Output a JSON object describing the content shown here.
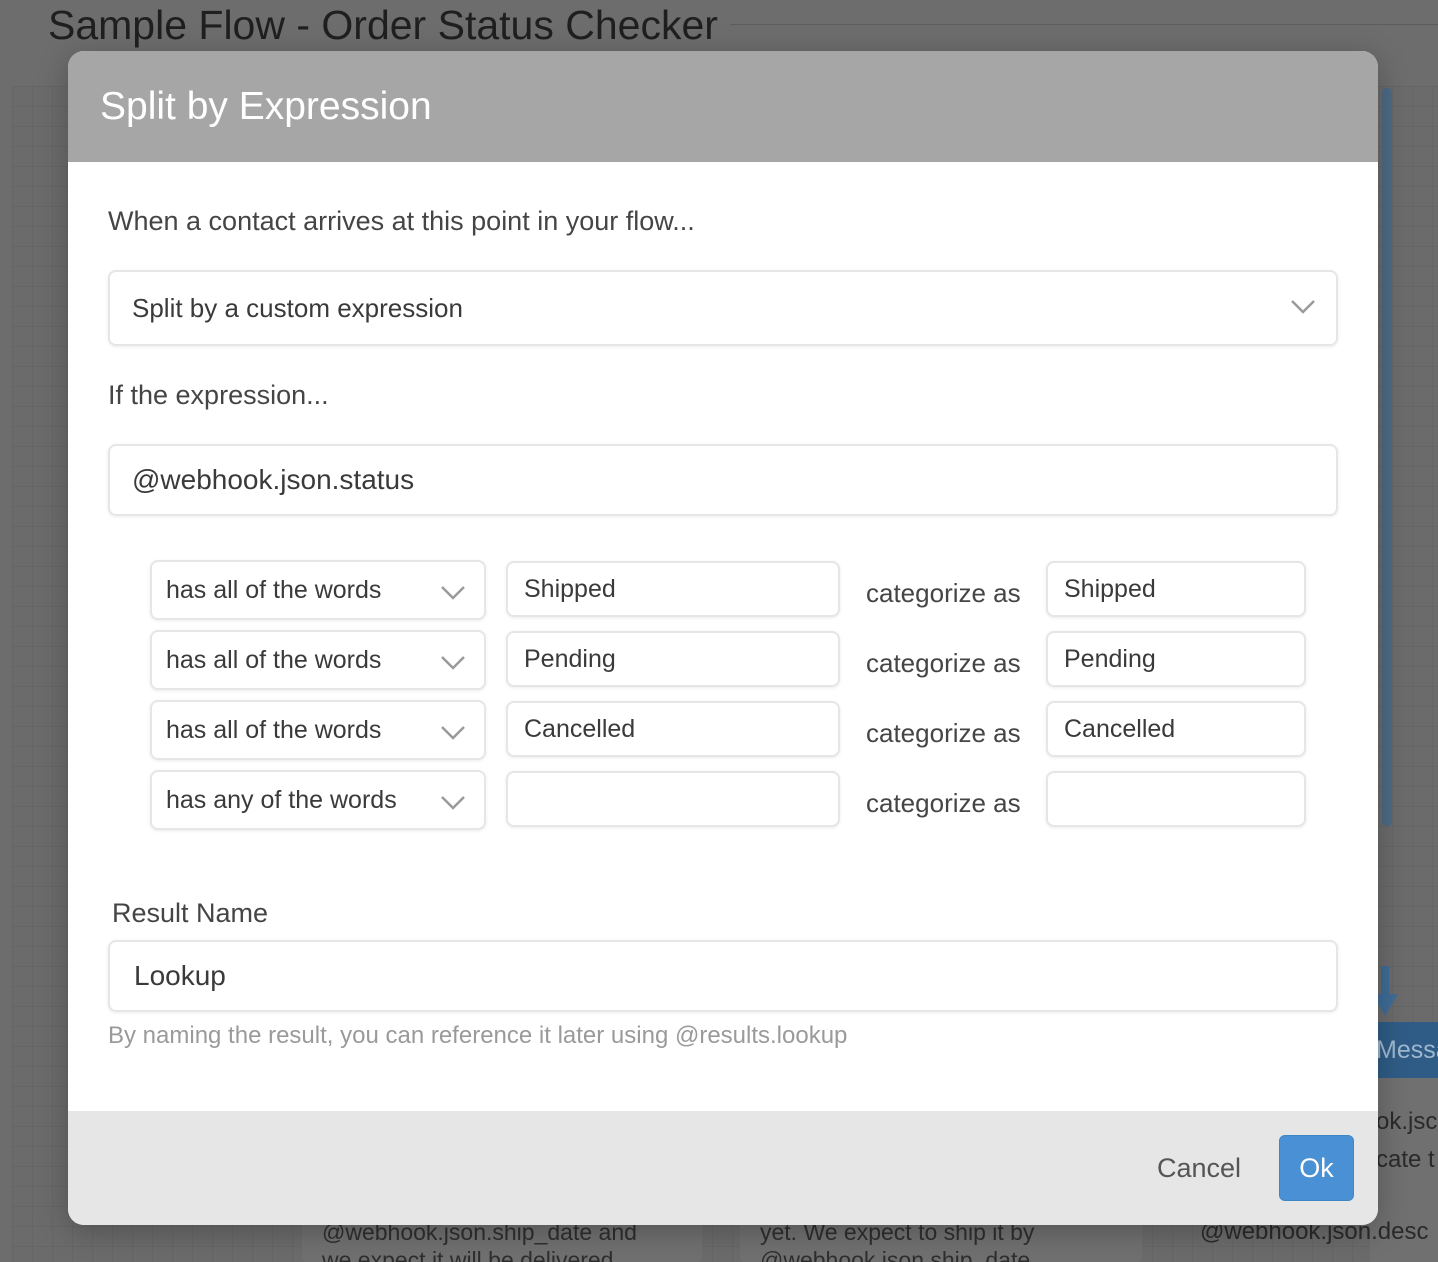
{
  "background": {
    "flow_title": "Sample Flow - Order Status Checker",
    "right_node_header": "Messa",
    "right_node_lines": [
      "ok.jsc",
      "cate t",
      "@webhook.json.desc"
    ],
    "card_left_lines": [
      "@webhook.json.ship_date and",
      "we expect it will be delivered"
    ],
    "card_mid_lines": [
      "yet. We expect to ship it by",
      "@webhook.json.ship_date"
    ]
  },
  "modal": {
    "title": "Split by Expression",
    "intro": "When a contact arrives at this point in your flow...",
    "split_type": "Split by a custom expression",
    "expression_label": "If the expression...",
    "expression_value": "@webhook.json.status",
    "rules": [
      {
        "operator": "has all of the words",
        "argument": "Shipped",
        "category_label": "categorize as",
        "category": "Shipped"
      },
      {
        "operator": "has all of the words",
        "argument": "Pending",
        "category_label": "categorize as",
        "category": "Pending"
      },
      {
        "operator": "has all of the words",
        "argument": "Cancelled",
        "category_label": "categorize as",
        "category": "Cancelled"
      },
      {
        "operator": "has any of the words",
        "argument": "",
        "category_label": "categorize as",
        "category": ""
      }
    ],
    "result_name_label": "Result Name",
    "result_name_value": "Lookup",
    "result_hint": "By naming the result, you can reference it later using @results.lookup",
    "cancel_label": "Cancel",
    "ok_label": "Ok"
  },
  "colors": {
    "header": "#a6a6a6",
    "primary": "#4a90d4",
    "footer": "#e6e6e6",
    "overlay": "#6d6d6d"
  },
  "icons": {
    "dropdown": "chevron-down-icon",
    "flow_connector": "arrow-down-icon"
  }
}
